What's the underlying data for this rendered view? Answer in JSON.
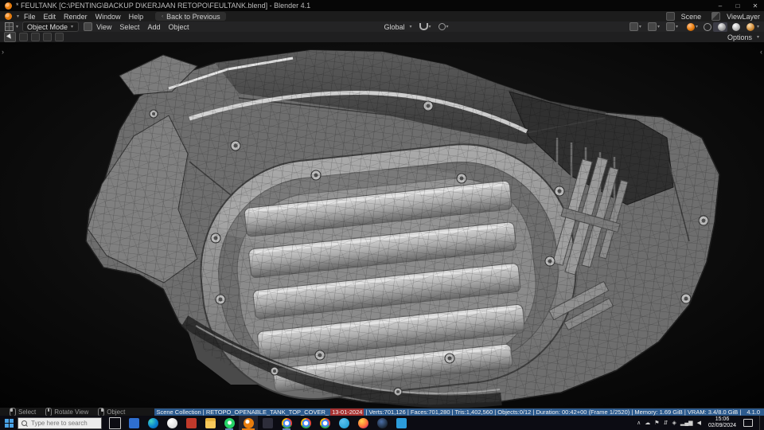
{
  "window": {
    "title": "* FEULTANK [C:\\PENTING\\BACKUP D\\KERJAAN RETOPO\\FEULTANK.blend] - Blender 4.1",
    "minimize": "–",
    "maximize": "□",
    "close": "✕"
  },
  "glyphs": {
    "caret": "▾",
    "back": "‹",
    "open_toolbar": "›",
    "open_sidebar": "‹"
  },
  "topbar": {
    "menus": [
      "File",
      "Edit",
      "Render",
      "Window",
      "Help"
    ],
    "back_button": "Back to Previous",
    "scene_label": "Scene",
    "viewlayer_label": "ViewLayer"
  },
  "header": {
    "mode": "Object Mode",
    "menus": [
      "View",
      "Select",
      "Add",
      "Object"
    ],
    "orientation": "Global",
    "options": "Options"
  },
  "status": {
    "hints": [
      {
        "label": "Select"
      },
      {
        "label": "Rotate View"
      },
      {
        "label": "Object"
      }
    ],
    "stats_scene": "Scene Collection  |  RETOPO_OPENABLE_TANK_TOP_COVER_",
    "stats_date": "13-01-2024",
    "stats_geo": "  |  Verts:701,126 | Faces:701,280 | Tris:1,402,560 | Objects:0/12 | Duration: 00:42+00 (Frame 1/2520) | Memory: 1.69 GiB | VRAM: 3.4/8.0 GiB |",
    "version": "4.1.0"
  },
  "taskbar": {
    "search_placeholder": "Type here to search",
    "tray_icons": [
      "∧",
      "☁",
      "⚑",
      "⇵",
      "◈",
      "▂▄▆",
      "◀"
    ],
    "time": "15:06",
    "date": "02/09/2024"
  },
  "colors": {
    "blender_orange": "#e87d0d",
    "stats_blue": "#2d5b8e",
    "stats_red": "#a83232"
  }
}
